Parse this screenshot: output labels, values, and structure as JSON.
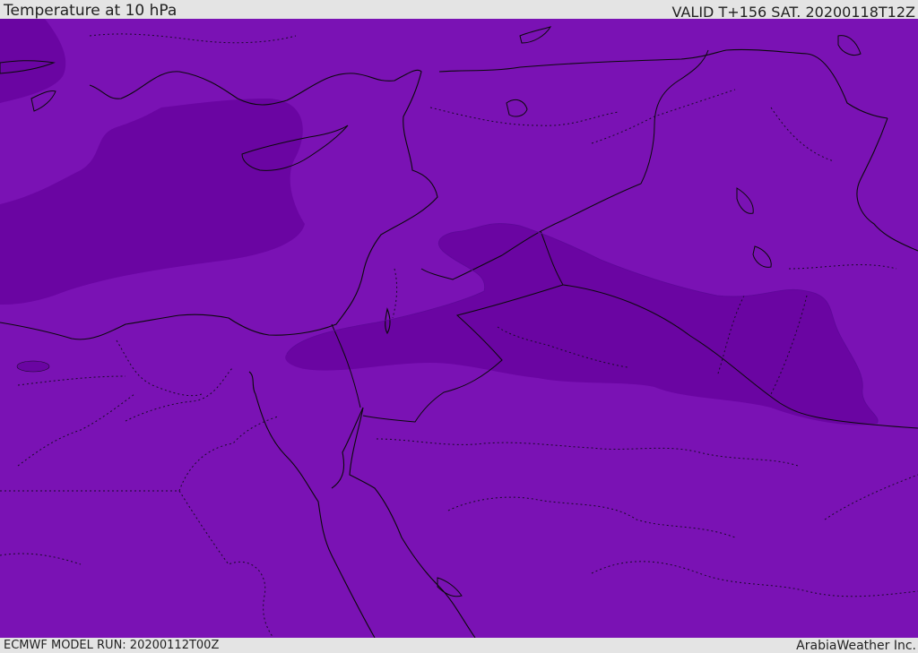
{
  "header": {
    "title": "Temperature at 10 hPa",
    "valid": "VALID T+156 SAT. 20200118T12Z"
  },
  "footer": {
    "model_run": "ECMWF MODEL RUN: 20200112T00Z",
    "credit": "ArabiaWeather Inc."
  },
  "map": {
    "field_colors": {
      "base": "#7a12b4",
      "cold_band": "#6a05a2",
      "coastline": "#0a0a0a",
      "borders": "#1a0a2a"
    }
  }
}
